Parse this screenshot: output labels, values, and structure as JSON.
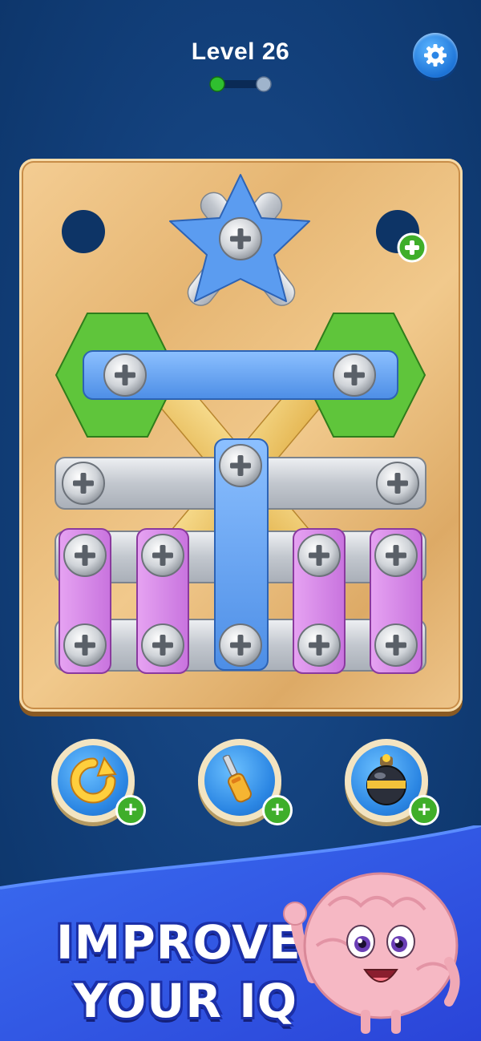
{
  "header": {
    "level_label": "Level 26",
    "progress_done": 1,
    "progress_total": 2
  },
  "boosters": [
    {
      "name": "refresh-booster",
      "icon": "refresh-icon"
    },
    {
      "name": "screwdriver-booster",
      "icon": "screwdriver-icon"
    },
    {
      "name": "bomb-booster",
      "icon": "bomb-icon"
    }
  ],
  "banner": {
    "line1": "IMPROVE",
    "line2": "YOUR IQ",
    "mascot": "brain-mascot"
  },
  "colors": {
    "background": "#123f7a",
    "board": "#e9bd7c",
    "star": "#5b9cf0",
    "hexagon": "#5fc53b",
    "bar_blue": "#6aa7f0",
    "bar_purple": "#d890e8",
    "bar_silver": "#c8ccd2",
    "bar_gold": "#f0c96a",
    "plus_badge": "#3fae2a"
  }
}
